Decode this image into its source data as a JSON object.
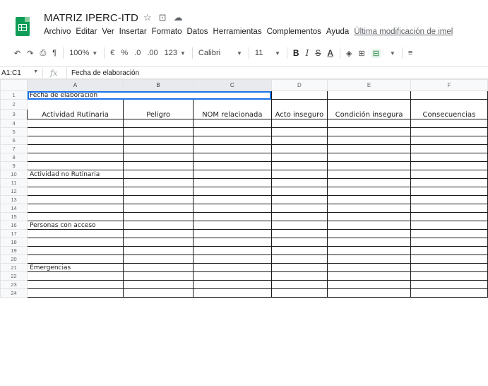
{
  "titlebar": {
    "doc_title": "MATRIZ IPERC-ITD",
    "icons": [
      "star-icon",
      "move-to-folder-icon",
      "cloud-status-icon"
    ],
    "menu": [
      "Archivo",
      "Editar",
      "Ver",
      "Insertar",
      "Formato",
      "Datos",
      "Herramientas",
      "Complementos",
      "Ayuda"
    ],
    "last_edit": "Última modificación de imel"
  },
  "toolbar": {
    "undo": "↶",
    "redo": "↷",
    "print": "⎙",
    "paint_format": "¶",
    "zoom": "100%",
    "currency": "€",
    "percent": "%",
    "dec_less": ".0",
    "dec_more": ".00",
    "more_formats": "123",
    "font": "Calibri",
    "font_size": "11",
    "bold": "B",
    "italic": "I",
    "strike": "S",
    "underline": "A",
    "fill": "◈",
    "borders": "⊞",
    "merge": "⊟",
    "align": "≡"
  },
  "formula_bar": {
    "name_box": "A1:C1",
    "fx": "fx",
    "content": "Fecha de elaboración"
  },
  "sheet": {
    "columns": [
      "A",
      "B",
      "C",
      "D",
      "E",
      "F"
    ],
    "rows": [
      {
        "n": "1",
        "cells": [
          "Fecha de elaboración",
          "",
          "",
          "",
          "",
          ""
        ]
      },
      {
        "n": "2",
        "cells": [
          "",
          "",
          "",
          "",
          "",
          ""
        ]
      },
      {
        "n": "3",
        "cells": [
          "Actividad Rutinaria",
          "Peligro",
          "NOM relacionada",
          "Acto inseguro",
          "Condición insegura",
          "Consecuencias"
        ]
      },
      {
        "n": "4",
        "cells": [
          "",
          "",
          "",
          "",
          "",
          ""
        ]
      },
      {
        "n": "5",
        "cells": [
          "",
          "",
          "",
          "",
          "",
          ""
        ]
      },
      {
        "n": "6",
        "cells": [
          "",
          "",
          "",
          "",
          "",
          ""
        ]
      },
      {
        "n": "7",
        "cells": [
          "",
          "",
          "",
          "",
          "",
          ""
        ]
      },
      {
        "n": "8",
        "cells": [
          "",
          "",
          "",
          "",
          "",
          ""
        ]
      },
      {
        "n": "9",
        "cells": [
          "",
          "",
          "",
          "",
          "",
          ""
        ]
      },
      {
        "n": "10",
        "cells": [
          "Actividad no Rutinaria",
          "",
          "",
          "",
          "",
          ""
        ]
      },
      {
        "n": "11",
        "cells": [
          "",
          "",
          "",
          "",
          "",
          ""
        ]
      },
      {
        "n": "12",
        "cells": [
          "",
          "",
          "",
          "",
          "",
          ""
        ]
      },
      {
        "n": "13",
        "cells": [
          "",
          "",
          "",
          "",
          "",
          ""
        ]
      },
      {
        "n": "14",
        "cells": [
          "",
          "",
          "",
          "",
          "",
          ""
        ]
      },
      {
        "n": "15",
        "cells": [
          "",
          "",
          "",
          "",
          "",
          ""
        ]
      },
      {
        "n": "16",
        "cells": [
          "Personas con acceso",
          "",
          "",
          "",
          "",
          ""
        ]
      },
      {
        "n": "17",
        "cells": [
          "",
          "",
          "",
          "",
          "",
          ""
        ]
      },
      {
        "n": "18",
        "cells": [
          "",
          "",
          "",
          "",
          "",
          ""
        ]
      },
      {
        "n": "19",
        "cells": [
          "",
          "",
          "",
          "",
          "",
          ""
        ]
      },
      {
        "n": "20",
        "cells": [
          "",
          "",
          "",
          "",
          "",
          ""
        ]
      },
      {
        "n": "21",
        "cells": [
          "Emergencias",
          "",
          "",
          "",
          "",
          ""
        ]
      },
      {
        "n": "22",
        "cells": [
          "",
          "",
          "",
          "",
          "",
          ""
        ]
      },
      {
        "n": "23",
        "cells": [
          "",
          "",
          "",
          "",
          "",
          ""
        ]
      },
      {
        "n": "24",
        "cells": [
          "",
          "",
          "",
          "",
          "",
          ""
        ]
      }
    ]
  },
  "colors": {
    "sheets_green": "#0f9d58",
    "selection_blue": "#1a73e8",
    "header_bg": "#f8f9fa"
  }
}
